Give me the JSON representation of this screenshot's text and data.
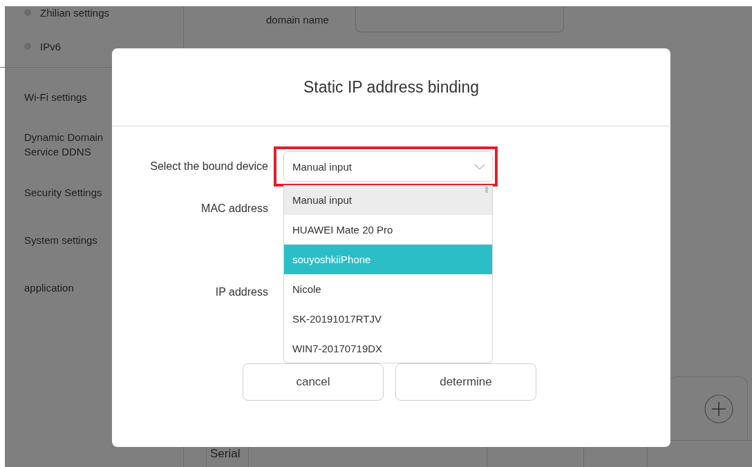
{
  "sidebar": {
    "items": [
      {
        "label": "Zhilian settings",
        "kind": "sub"
      },
      {
        "label": "IPv6",
        "kind": "sub"
      },
      {
        "label": "Wi-Fi settings",
        "kind": "main"
      },
      {
        "label": "Dynamic Domain\nService DDNS",
        "kind": "main"
      },
      {
        "label": "Security Settings",
        "kind": "main"
      },
      {
        "label": "System settings",
        "kind": "main"
      },
      {
        "label": "application",
        "kind": "main"
      }
    ]
  },
  "main": {
    "domain_label": "domain name",
    "table_columns": [
      "Serial"
    ]
  },
  "dialog": {
    "title": "Static IP address binding",
    "device_label": "Select the bound device",
    "device_value": "Manual input",
    "mac_label": "MAC address",
    "ip_label": "IP address",
    "options": [
      {
        "label": "Manual input",
        "current": true,
        "selected": false
      },
      {
        "label": "HUAWEI Mate 20 Pro",
        "current": false,
        "selected": false
      },
      {
        "label": "souyoshkiiPhone",
        "current": false,
        "selected": true
      },
      {
        "label": "Nicole",
        "current": false,
        "selected": false
      },
      {
        "label": "SK-20191017RTJV",
        "current": false,
        "selected": false
      },
      {
        "label": "WIN7-20170719DX",
        "current": false,
        "selected": false
      }
    ],
    "buttons": [
      "cancel",
      "determine"
    ]
  }
}
